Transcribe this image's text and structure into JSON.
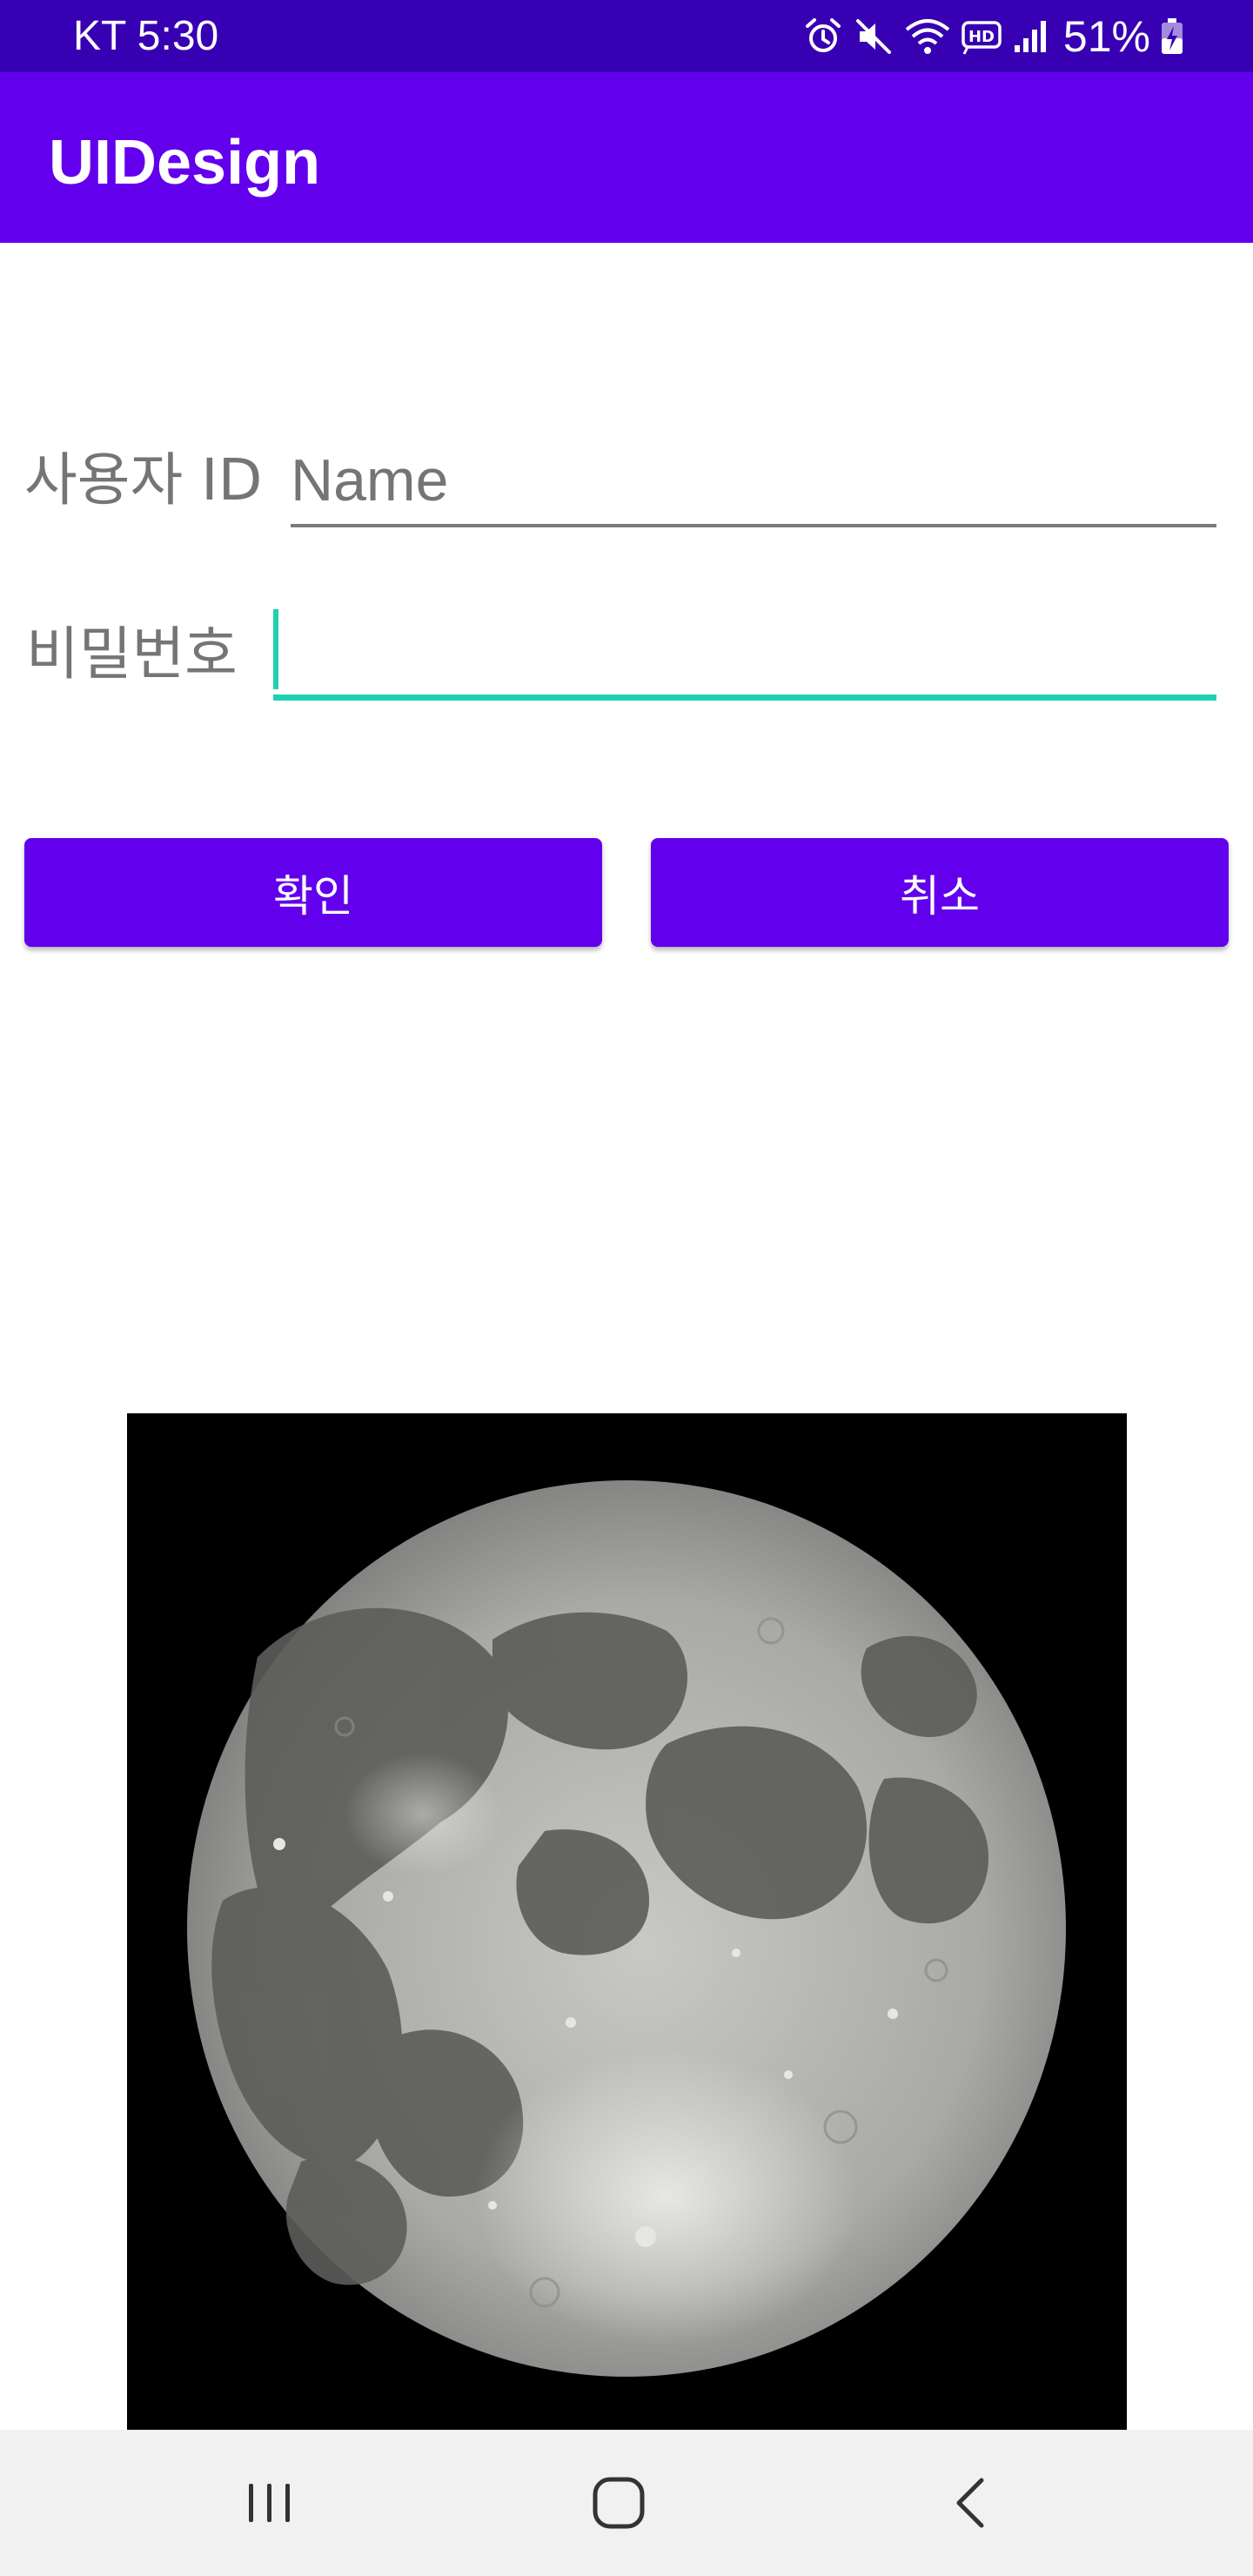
{
  "status_bar": {
    "carrier_time": "KT 5:30",
    "battery": "51%",
    "icons": [
      "alarm-icon",
      "mute-icon",
      "wifi-icon",
      "hd-icon",
      "signal-icon",
      "battery-charging-icon"
    ],
    "background": "#3700b3"
  },
  "app_bar": {
    "title": "UIDesign",
    "background": "#6200ee"
  },
  "form": {
    "user_id_label": "사용자 ID",
    "user_id_placeholder": "Name",
    "password_label": "비밀번호",
    "password_value": "",
    "focus_color": "#1fd1b0"
  },
  "buttons": {
    "confirm_label": "확인",
    "cancel_label": "취소",
    "color": "#6200ee"
  },
  "image": {
    "subject": "full moon photograph",
    "icon": "moon-image"
  },
  "nav_bar": {
    "icons": [
      "recent-apps-icon",
      "home-icon",
      "back-icon"
    ]
  }
}
